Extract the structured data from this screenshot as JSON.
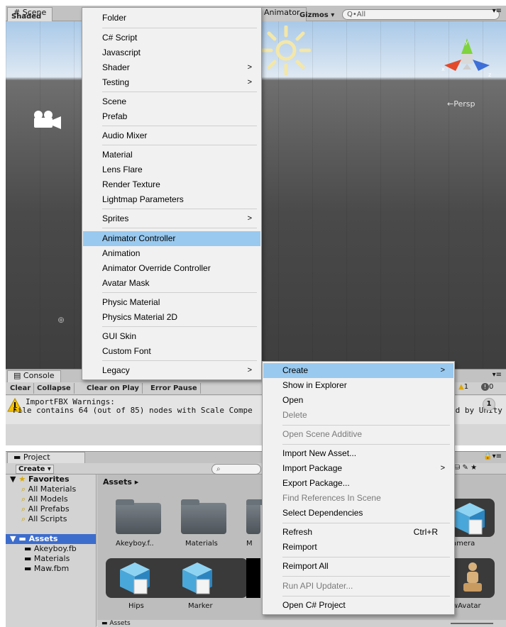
{
  "scene": {
    "tab_label": "# Scene",
    "shading": "Shaded",
    "animator_tab": "Animator",
    "gizmos": "Gizmos",
    "search_placeholder": "Q•All",
    "persp": "←Persp",
    "gizmo_axes": {
      "y": "y",
      "x": "x",
      "z": "z"
    }
  },
  "console": {
    "tab_label": "Console",
    "buttons": [
      "Clear",
      "Collapse",
      "Clear on Play",
      "Error Pause"
    ],
    "warn_count": "1",
    "error_count": "0",
    "message_line1": "ImportFBX Warnings:",
    "message_line2": "File contains 64 (out of 85) nodes with Scale Compe",
    "message_tail": "ed by Unity",
    "collapse_count": "1"
  },
  "project": {
    "tab_label": "Project",
    "create_label": "Create",
    "favorites": {
      "header": "Favorites",
      "items": [
        "All Materials",
        "All Models",
        "All Prefabs",
        "All Scripts"
      ]
    },
    "assets_tree": {
      "header": "Assets",
      "items": [
        "Akeyboy.fb",
        "Materials",
        "Maw.fbm"
      ]
    },
    "breadcrumb": "Assets",
    "grid_row1": [
      "Akeyboy.f..",
      "Materials",
      "M",
      "amera"
    ],
    "grid_row2": [
      "Hips",
      "Marker",
      "wAvatar"
    ],
    "footer_path": "Assets"
  },
  "create_menu": {
    "items": [
      {
        "label": "Folder"
      },
      {
        "label": "C# Script"
      },
      {
        "label": "Javascript"
      },
      {
        "label": "Shader",
        "submenu": true
      },
      {
        "label": "Testing",
        "submenu": true
      },
      {
        "label": "Scene"
      },
      {
        "label": "Prefab"
      },
      {
        "label": "Audio Mixer"
      },
      {
        "label": "Material"
      },
      {
        "label": "Lens Flare"
      },
      {
        "label": "Render Texture"
      },
      {
        "label": "Lightmap Parameters"
      },
      {
        "label": "Sprites",
        "submenu": true
      },
      {
        "label": "Animator Controller",
        "highlighted": true
      },
      {
        "label": "Animation"
      },
      {
        "label": "Animator Override Controller"
      },
      {
        "label": "Avatar Mask"
      },
      {
        "label": "Physic Material"
      },
      {
        "label": "Physics Material 2D"
      },
      {
        "label": "GUI Skin"
      },
      {
        "label": "Custom Font"
      },
      {
        "label": "Legacy",
        "submenu": true
      }
    ]
  },
  "context_menu": {
    "items": [
      {
        "label": "Create",
        "submenu": true,
        "highlighted": true
      },
      {
        "label": "Show in Explorer"
      },
      {
        "label": "Open"
      },
      {
        "label": "Delete",
        "disabled": true
      },
      {
        "label": "Open Scene Additive",
        "disabled": true
      },
      {
        "label": "Import New Asset..."
      },
      {
        "label": "Import Package",
        "submenu": true
      },
      {
        "label": "Export Package..."
      },
      {
        "label": "Find References In Scene",
        "disabled": true
      },
      {
        "label": "Select Dependencies"
      },
      {
        "label": "Refresh",
        "shortcut": "Ctrl+R"
      },
      {
        "label": "Reimport"
      },
      {
        "label": "Reimport All"
      },
      {
        "label": "Run API Updater...",
        "disabled": true
      },
      {
        "label": "Open C# Project"
      }
    ]
  },
  "colors": {
    "menu_highlight": "#99c9ef",
    "menu_bg": "#f1f1f1",
    "warning": "#f5c200"
  }
}
